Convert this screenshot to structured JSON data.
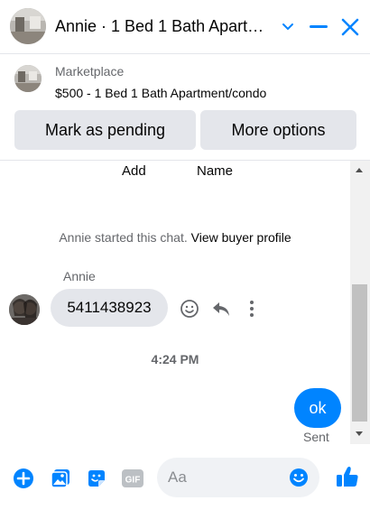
{
  "header": {
    "title": "Annie · 1 Bed 1 Bath Apart…"
  },
  "listing": {
    "source": "Marketplace",
    "price_title": "$500 - 1 Bed 1 Bath Apartment/condo",
    "mark_pending_label": "Mark as pending",
    "more_options_label": "More options"
  },
  "chat": {
    "top_labels": [
      "Add",
      "Name"
    ],
    "started_text": "Annie started this chat.",
    "buyer_profile_link": "View buyer profile",
    "sender_name": "Annie",
    "incoming_message": "5411438923",
    "timestamp": "4:24 PM",
    "outgoing_message": "ok",
    "status": "Sent"
  },
  "composer": {
    "placeholder": "Aa"
  },
  "colors": {
    "accent": "#0084ff",
    "bubble_in": "#e4e6eb",
    "secondary_text": "#65676b"
  },
  "icons": {
    "header": [
      "chevron-down-icon",
      "minimize-icon",
      "close-icon"
    ],
    "message_actions": [
      "smiley-icon",
      "reply-icon",
      "more-vertical-icon"
    ],
    "composer": [
      "plus-circle-icon",
      "photo-icon",
      "sticker-icon",
      "gif-icon",
      "emoji-icon",
      "thumbs-up-icon"
    ]
  }
}
